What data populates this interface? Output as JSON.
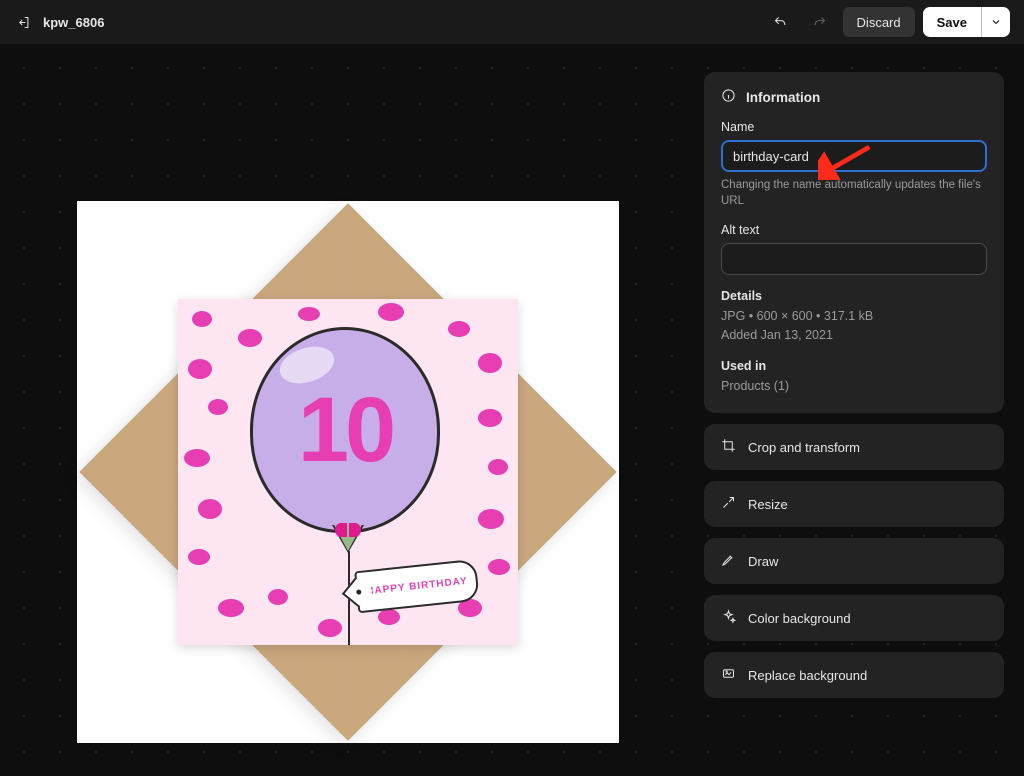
{
  "header": {
    "file_title": "kpw_6806",
    "discard_label": "Discard",
    "save_label": "Save"
  },
  "sidebar": {
    "info": {
      "title": "Information",
      "name_label": "Name",
      "name_value": "birthday-card",
      "name_help": "Changing the name automatically updates the file's URL",
      "alt_label": "Alt text",
      "alt_value": "",
      "details_label": "Details",
      "details_line": "JPG • 600 × 600 • 317.1 kB",
      "added_line": "Added Jan 13, 2021",
      "used_in_label": "Used in",
      "used_in_value": "Products (1)"
    },
    "actions": {
      "crop": "Crop and transform",
      "resize": "Resize",
      "draw": "Draw",
      "color_bg": "Color background",
      "replace_bg": "Replace background"
    }
  },
  "image": {
    "balloon_number": "10",
    "tag_text": "HAPPY BIRTHDAY"
  }
}
